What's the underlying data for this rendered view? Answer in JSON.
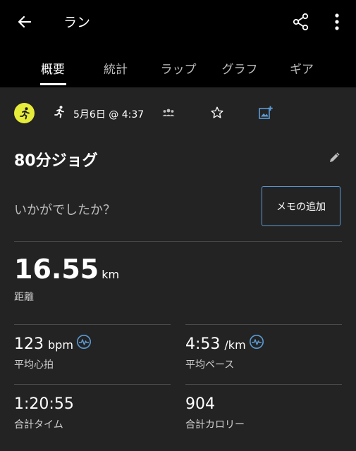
{
  "header": {
    "title": "ラン"
  },
  "tabs": [
    {
      "label": "概要",
      "active": true
    },
    {
      "label": "統計",
      "active": false
    },
    {
      "label": "ラップ",
      "active": false
    },
    {
      "label": "グラフ",
      "active": false
    },
    {
      "label": "ギア",
      "active": false
    }
  ],
  "info": {
    "date": "5月6日 @ 4:37"
  },
  "activity": {
    "name": "80分ジョグ",
    "prompt": "いかがでしたか？",
    "memo_button": "メモの追加"
  },
  "distance": {
    "value": "16.55",
    "unit": "km",
    "label": "距離"
  },
  "stats": {
    "heart_rate": {
      "value": "123",
      "unit": "bpm",
      "label": "平均心拍"
    },
    "pace": {
      "value": "4:53",
      "unit": "/km",
      "label": "平均ペース"
    },
    "time": {
      "value": "1:20:55",
      "label": "合計タイム"
    },
    "calories": {
      "value": "904",
      "label": "合計カロリー"
    }
  },
  "colors": {
    "badge": "#e6ec3a",
    "accent": "#5b9bd5",
    "background": "#232323",
    "appbar": "#000000"
  }
}
